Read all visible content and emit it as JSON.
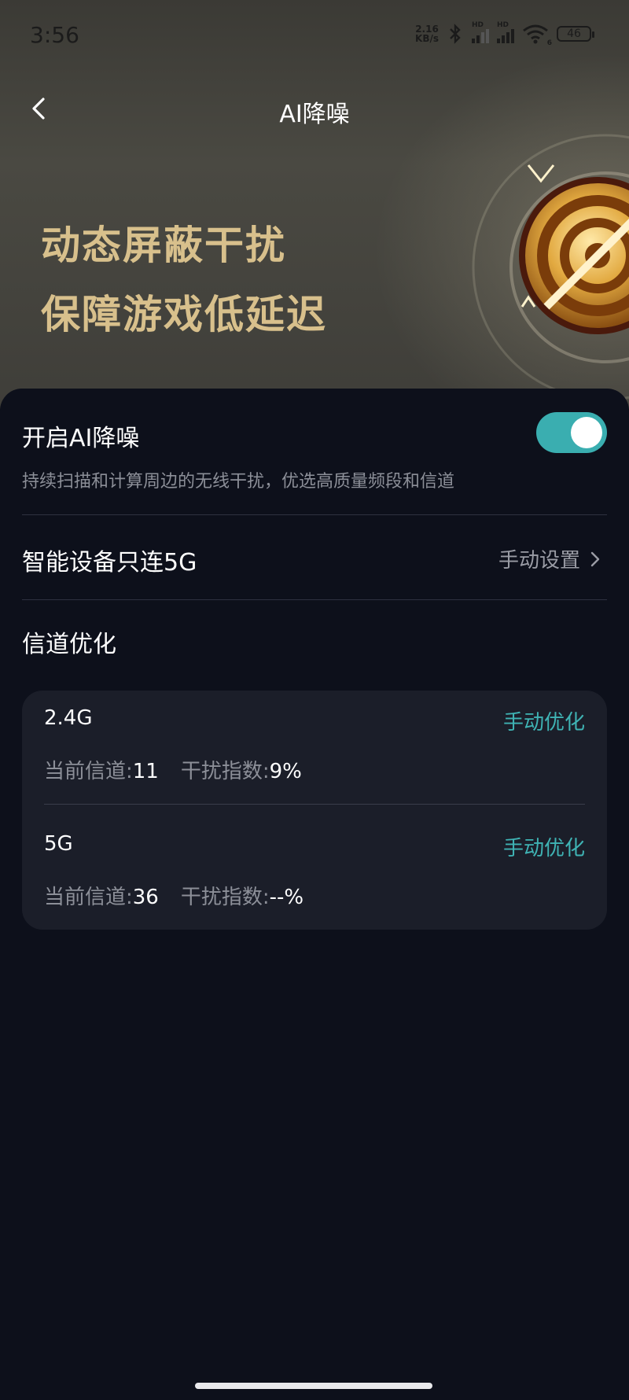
{
  "status_bar": {
    "time": "3:56",
    "net_speed_value": "2.16",
    "net_speed_unit": "KB/s",
    "battery": "46",
    "signal_label_1": "HD",
    "signal_label_2": "HD",
    "wifi_badge": "6"
  },
  "header": {
    "title": "AI降噪"
  },
  "hero": {
    "line1": "动态屏蔽干扰",
    "line2": "保障游戏低延迟"
  },
  "ai_noise": {
    "title": "开启AI降噪",
    "description": "持续扫描和计算周边的无线干扰，优选高质量频段和信道",
    "enabled": true
  },
  "smart_5g": {
    "title": "智能设备只连5G",
    "action": "手动设置"
  },
  "channel_optimization": {
    "title": "信道优化",
    "bands": [
      {
        "name": "2.4G",
        "action": "手动优化",
        "channel_label": "当前信道:",
        "channel_value": "11",
        "interference_label": "干扰指数:",
        "interference_value": "9%"
      },
      {
        "name": "5G",
        "action": "手动优化",
        "channel_label": "当前信道:",
        "channel_value": "36",
        "interference_label": "干扰指数:",
        "interference_value": "--%"
      }
    ]
  },
  "colors": {
    "accent": "#3fb3b4",
    "background": "#0d101b",
    "card": "#1b1e29",
    "hero_text": "#d8c08c"
  }
}
